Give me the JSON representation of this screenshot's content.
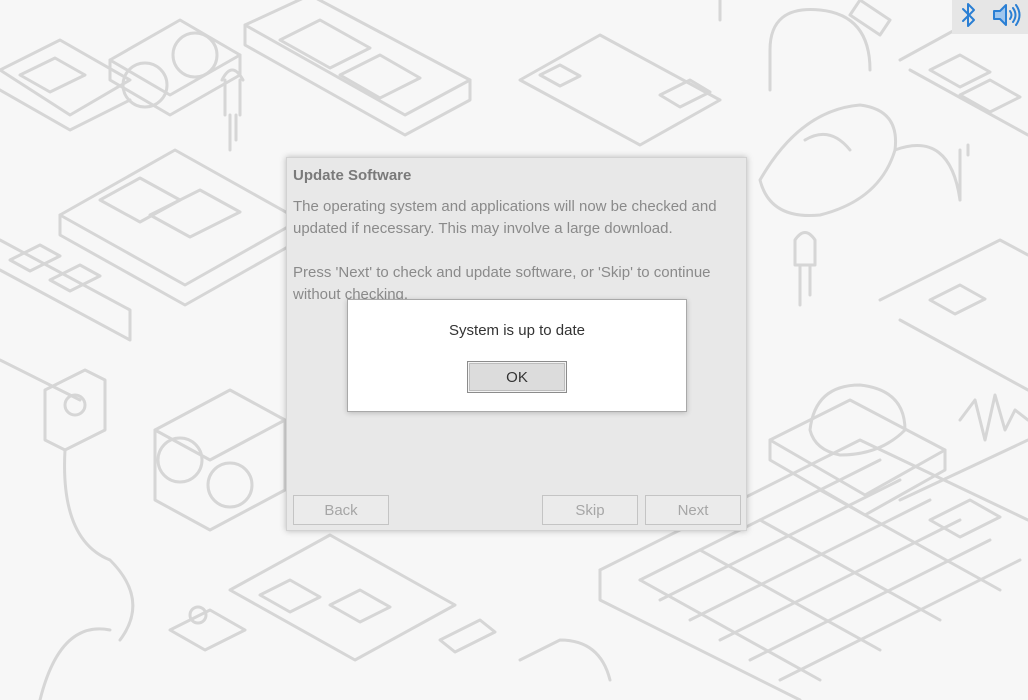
{
  "desktop": {
    "wallpaper": "electronics-line-art-icon",
    "colors": {
      "background": "#f7f7f7",
      "line_art": "#d6d6d6"
    }
  },
  "tray": {
    "icons": [
      "bluetooth-icon",
      "volume-icon"
    ],
    "colors": {
      "icon": "#2a7fd4",
      "background": "#e6e6e6"
    }
  },
  "wizard": {
    "title": "Update Software",
    "paragraph1": "The operating system and applications will now be checked and updated if necessary. This may involve a large download.",
    "paragraph2": "Press 'Next' to check and update software, or 'Skip' to continue without checking.",
    "buttons": {
      "back": "Back",
      "skip": "Skip",
      "next": "Next"
    }
  },
  "modal": {
    "message": "System is up to date",
    "ok_label": "OK"
  }
}
